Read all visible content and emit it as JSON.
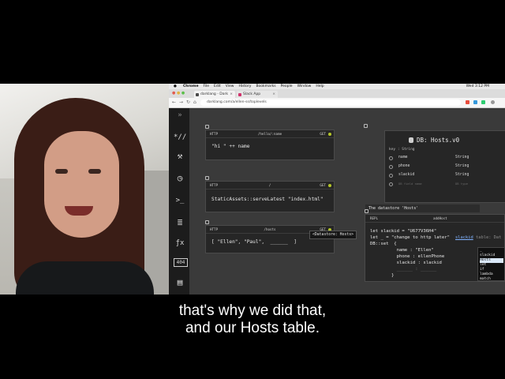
{
  "mac_menubar": {
    "apple": "",
    "items": [
      "Chrome",
      "File",
      "Edit",
      "View",
      "History",
      "Bookmarks",
      "People",
      "Window",
      "Help"
    ],
    "clock": "Wed 3:12 PM"
  },
  "browser": {
    "tabs": [
      {
        "label": "darklang - Dark"
      },
      {
        "label": "Slack App"
      }
    ],
    "url": "darklang.com/a/ellen-ss/toplevels"
  },
  "sidebar": {
    "icons": [
      "routing-icon",
      "settings-icon",
      "cron-icon",
      "repl-icon",
      "database-icon",
      "function-icon",
      "404-icon",
      "docs-icon"
    ],
    "labels": {
      "routes": "*//",
      "tools": "⚒",
      "cron": "◷",
      "repl": ">_",
      "db": "≣",
      "fn": "ƒx",
      "notfound": "404",
      "docs": "▤"
    }
  },
  "handlers": [
    {
      "method": "HTTP",
      "route": "/hello/:name",
      "verb": "GET",
      "body": "\"hi \" ++ name"
    },
    {
      "method": "HTTP",
      "route": "/",
      "verb": "GET",
      "body": "StaticAssets::serveLatest \"index.html\""
    },
    {
      "method": "HTTP",
      "route": "/hosts",
      "verb": "GET",
      "body": "[ \"Ellen\", \"Paul\",  ______  ]"
    }
  ],
  "db": {
    "title": "DB: Hosts.v0",
    "key_header": "key : String",
    "rows": [
      {
        "name": "name",
        "type": "String"
      },
      {
        "name": "phone",
        "type": "String"
      },
      {
        "name": "slackid",
        "type": "String"
      }
    ],
    "placeholder_name": "DB field name",
    "placeholder_type": "DB type"
  },
  "datastore_tooltip": "The datastore 'Hosts'",
  "repl": {
    "label": "REPL",
    "name": "addHost",
    "lines": [
      "let slackid = \"U677V36H4\"",
      "let _ = \"change to http later\"",
      "DB::set  {",
      "          name : \"Ellen\"",
      "          phone : ellenPhone",
      "          slackid : slackid",
      "          ______ : ______",
      "        }"
    ]
  },
  "autocomplete": {
    "input": "slackid",
    "hint": "table: Dat",
    "items": [
      "_",
      "slackid",
      "Hosts",
      "let",
      "if",
      "lambda",
      "match"
    ],
    "selected": "Hosts"
  },
  "datastore_badge": "<Datastore: Hosts>",
  "subtitles": [
    "that's why we did that,",
    "and our Hosts table."
  ]
}
